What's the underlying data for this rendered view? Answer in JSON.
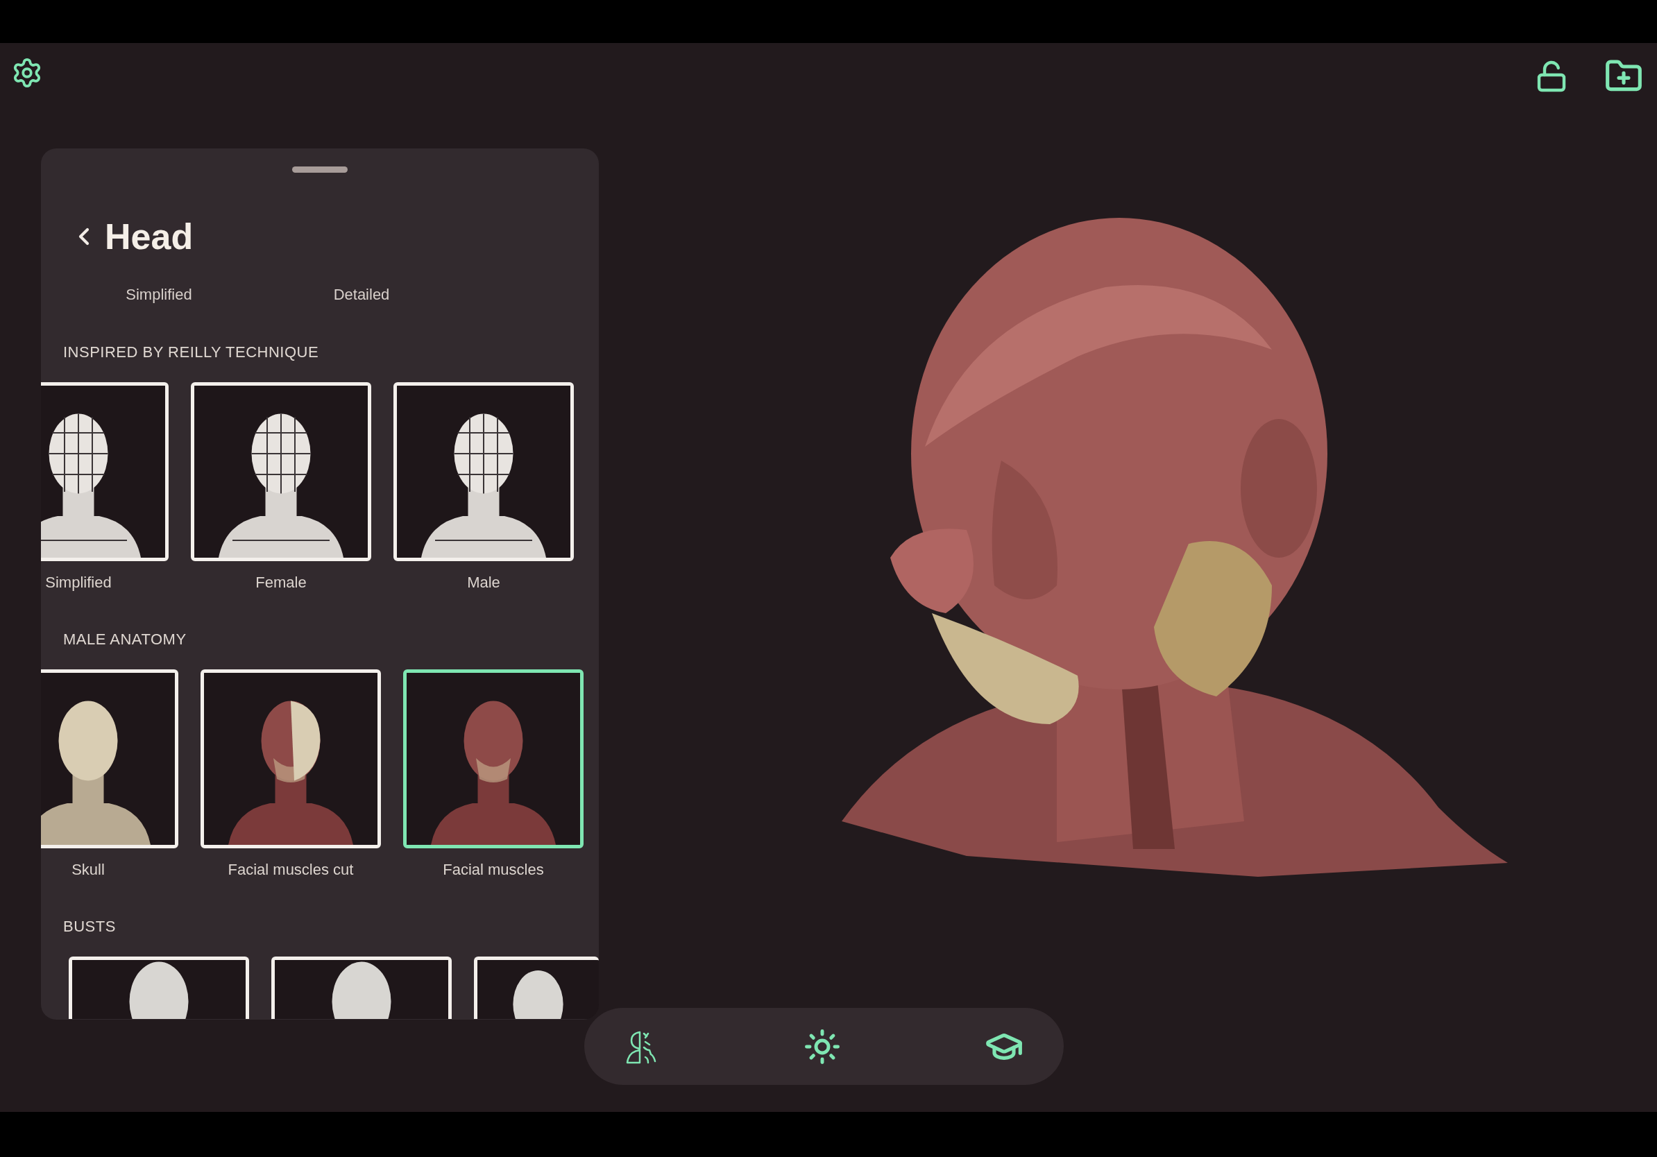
{
  "panel": {
    "title": "Head",
    "tabs": [
      {
        "label": "Simplified"
      },
      {
        "label": "Detailed"
      }
    ],
    "sections": [
      {
        "heading": "INSPIRED BY REILLY TECHNIQUE",
        "items": [
          {
            "label": "Simplified",
            "selected": false
          },
          {
            "label": "Female",
            "selected": false
          },
          {
            "label": "Male",
            "selected": false
          }
        ]
      },
      {
        "heading": "MALE ANATOMY",
        "items": [
          {
            "label": "Skull",
            "selected": false
          },
          {
            "label": "Facial muscles cut",
            "selected": false
          },
          {
            "label": "Facial muscles",
            "selected": true
          }
        ]
      },
      {
        "heading": "BUSTS",
        "items": [
          {
            "selected": false
          },
          {
            "selected": false
          },
          {
            "selected": false
          }
        ]
      }
    ]
  }
}
